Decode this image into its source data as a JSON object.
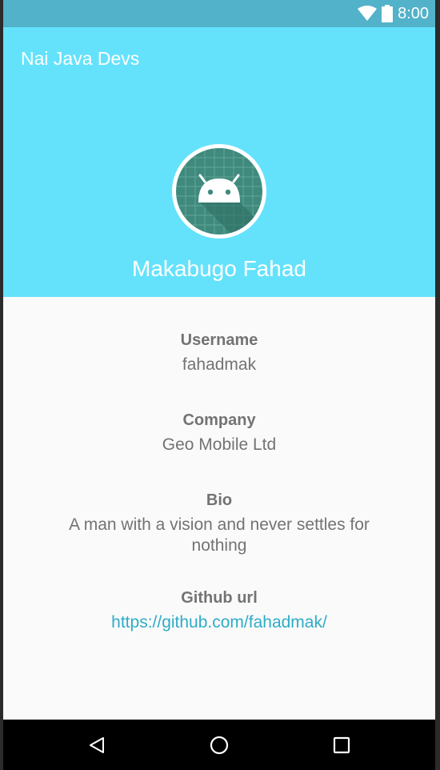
{
  "status_bar": {
    "time": "8:00",
    "icons": [
      "wifi-icon",
      "battery-icon"
    ]
  },
  "app_bar": {
    "title": "Nai Java Devs",
    "background_color": "#64e2fc"
  },
  "profile": {
    "avatar_icon": "android-icon",
    "name": "Makabugo Fahad"
  },
  "fields": [
    {
      "label": "Username",
      "value": "fahadmak"
    },
    {
      "label": "Company",
      "value": "Geo Mobile Ltd"
    },
    {
      "label": "Bio",
      "value": "A man with a vision and never settles for nothing"
    },
    {
      "label": "Github url",
      "value": "https://github.com/fahadmak/"
    }
  ],
  "nav_bar": {
    "buttons": [
      "back-icon",
      "home-icon",
      "recents-icon"
    ]
  },
  "colors": {
    "link": "#2eacc7",
    "text": "#737373",
    "status_bar": "#52b2c9"
  }
}
